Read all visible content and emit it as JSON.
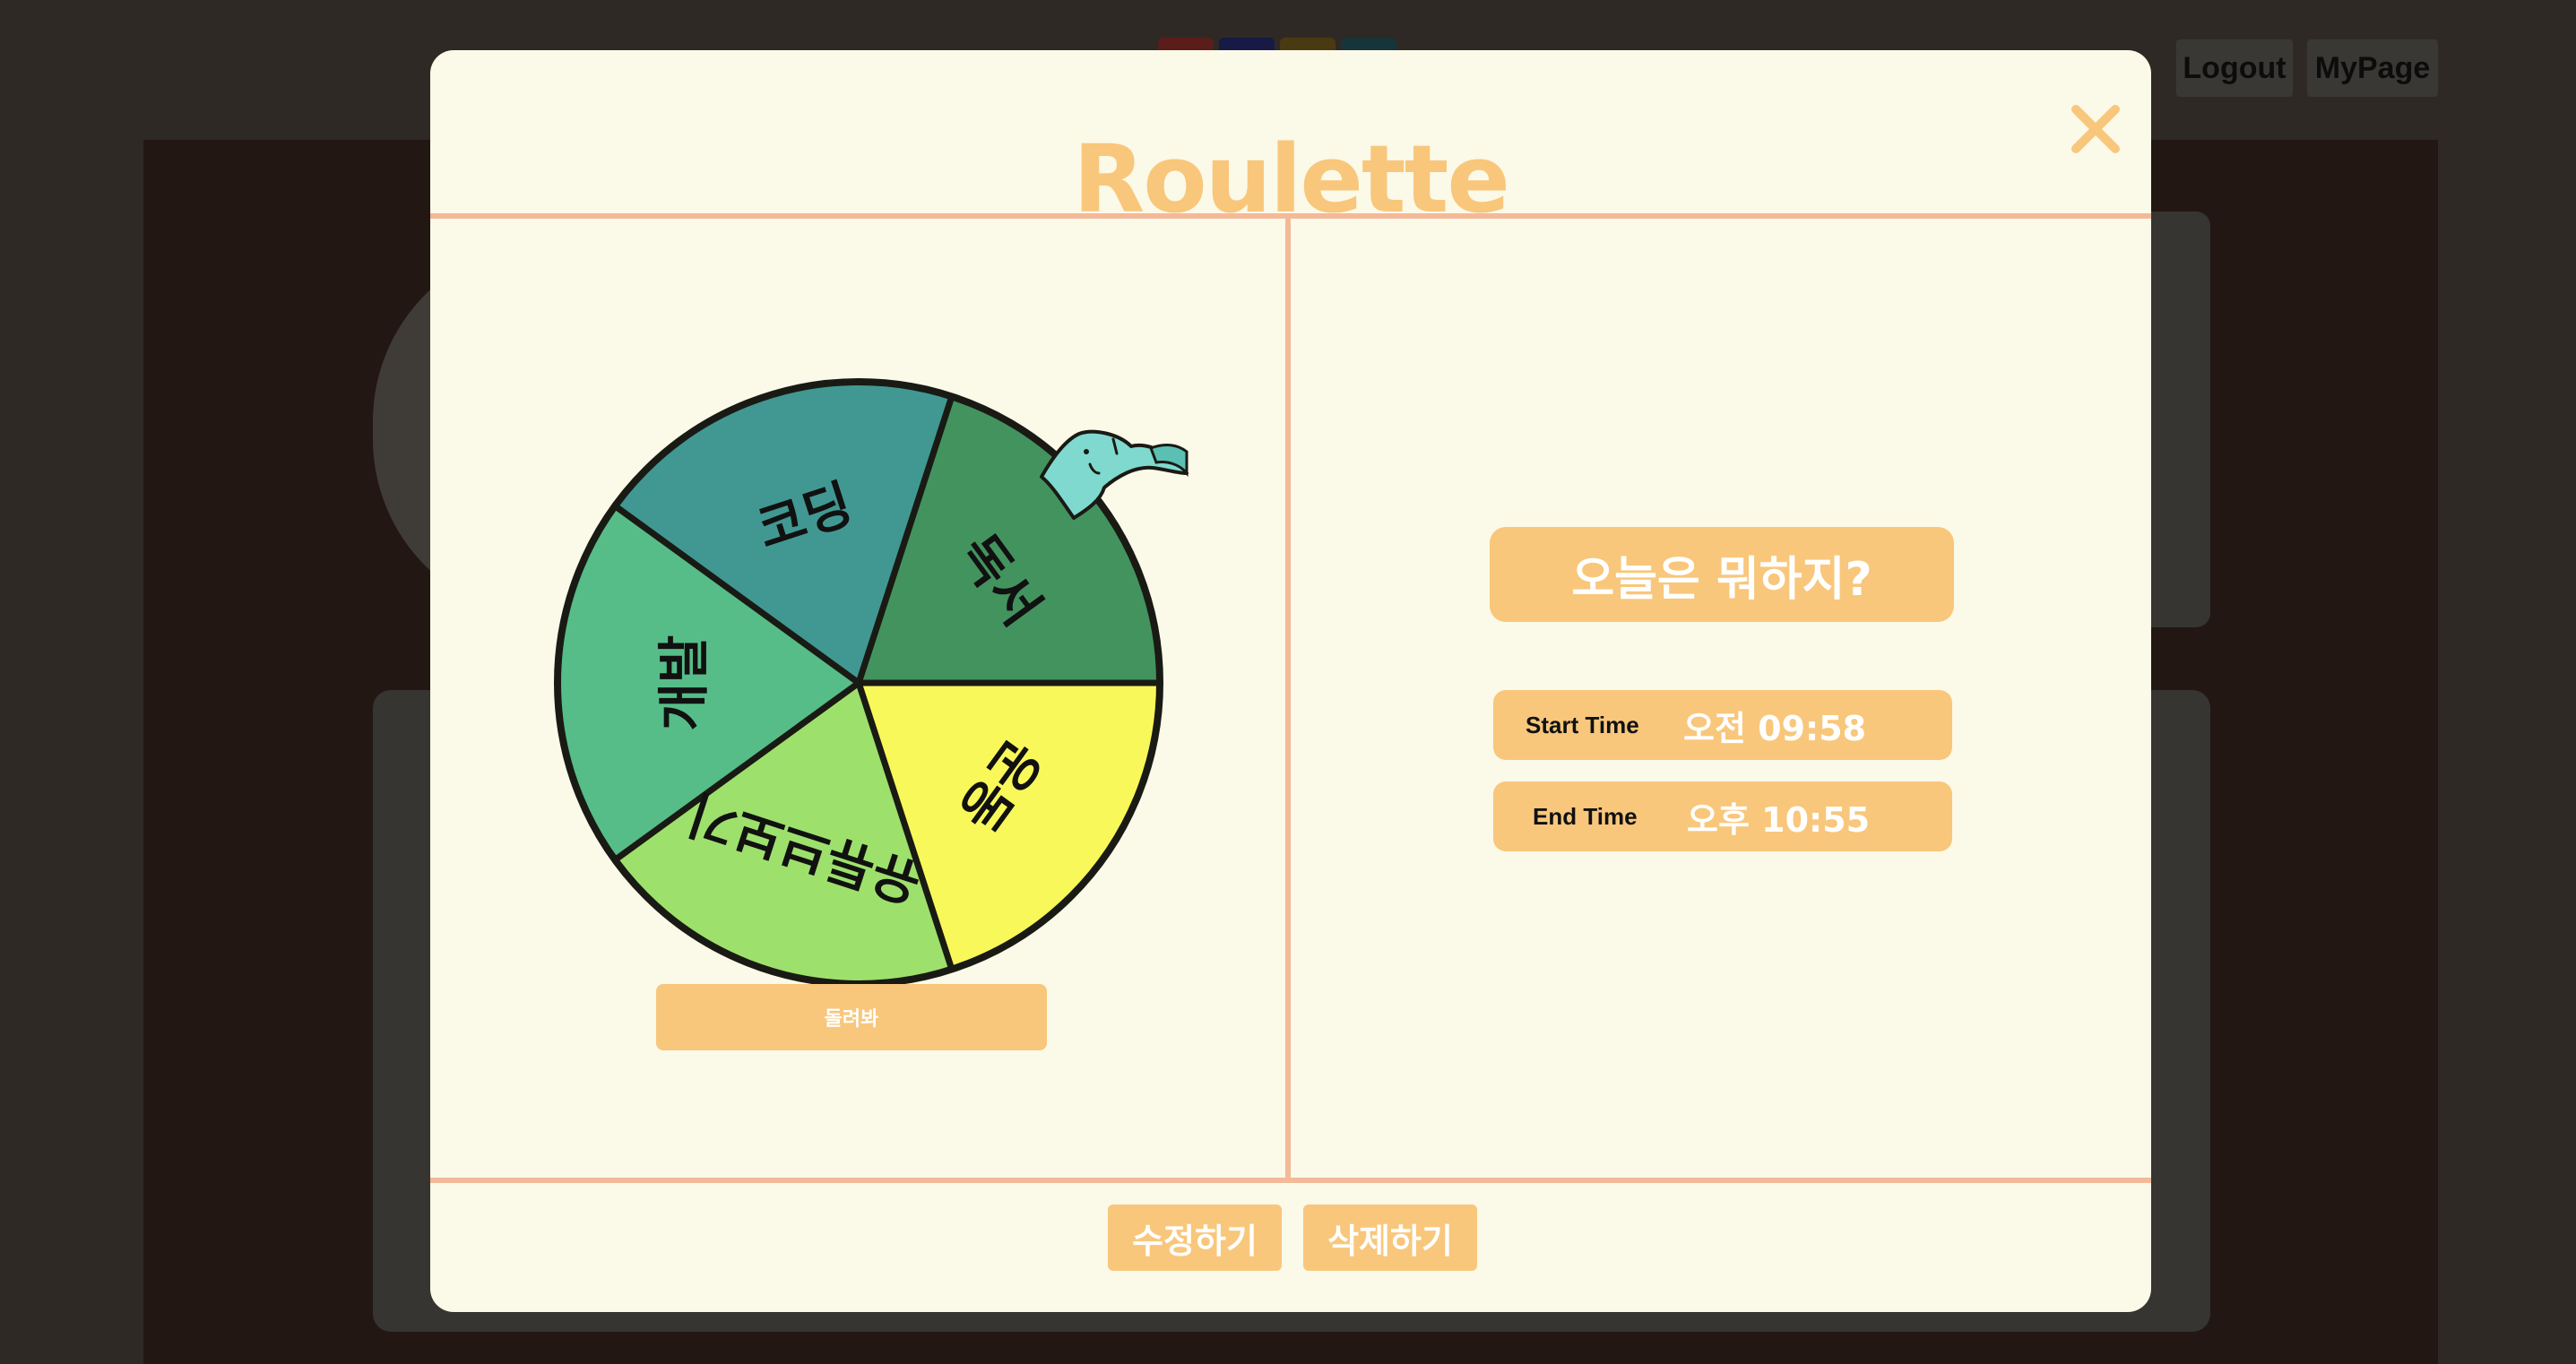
{
  "header": {
    "logout_label": "Logout",
    "mypage_label": "MyPage",
    "swatch_colors": [
      "#5a1d1a",
      "#161a45",
      "#4a3a12",
      "#16353a"
    ]
  },
  "modal": {
    "title": "Roulette",
    "close_icon": "close-icon"
  },
  "roulette": {
    "segments": [
      {
        "label": "독서",
        "color": "#43935f"
      },
      {
        "label": "운동",
        "color": "#f8f85a"
      },
      {
        "label": "유튜브보기",
        "color": "#9ee06c"
      },
      {
        "label": "개발",
        "color": "#56bd88"
      },
      {
        "label": "코딩",
        "color": "#419892"
      }
    ],
    "pointer_icon": "dinosaur-pointer-icon",
    "spin_label": "돌려봐"
  },
  "result": {
    "question": "오늘은 뭐하지?",
    "start_label": "Start Time",
    "start_value": "오전 09:58",
    "end_label": "End Time",
    "end_value": "오후 10:55"
  },
  "footer": {
    "edit_label": "수정하기",
    "delete_label": "삭제하기"
  },
  "colors": {
    "accent": "#f8c77b",
    "divider": "#f3b999",
    "modal_bg": "#fbf9e8",
    "wheel_stroke": "#1a1a14"
  }
}
